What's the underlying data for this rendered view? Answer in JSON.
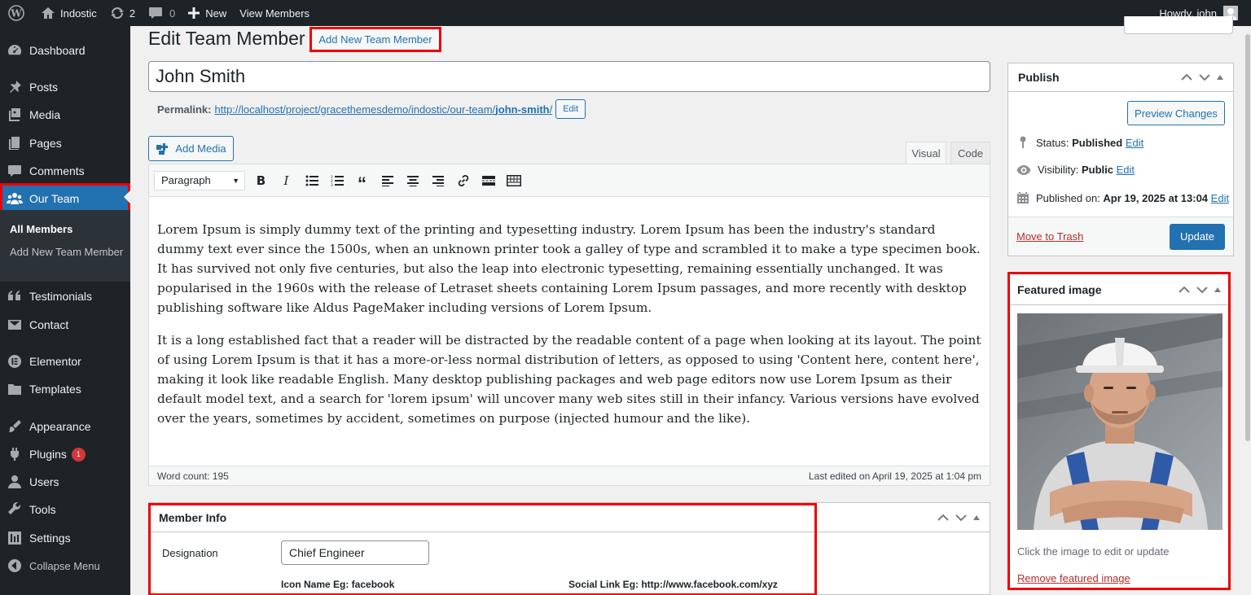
{
  "adminbar": {
    "site_name": "Indostic",
    "updates_count": "2",
    "comments_count": "0",
    "new_label": "New",
    "view_label": "View Members",
    "howdy": "Howdy, john"
  },
  "sidebar": {
    "dashboard": "Dashboard",
    "posts": "Posts",
    "media": "Media",
    "pages": "Pages",
    "comments": "Comments",
    "our_team": "Our Team",
    "sub_all": "All Members",
    "sub_add": "Add New Team Member",
    "testimonials": "Testimonials",
    "contact": "Contact",
    "elementor": "Elementor",
    "templates": "Templates",
    "appearance": "Appearance",
    "plugins": "Plugins",
    "plugins_badge": "1",
    "users": "Users",
    "tools": "Tools",
    "settings": "Settings",
    "collapse": "Collapse Menu"
  },
  "header": {
    "title": "Edit Team Member",
    "add_new": "Add New Team Member"
  },
  "post": {
    "title": "John Smith",
    "permalink_label": "Permalink:",
    "permalink_base": "http://localhost/project/gracethemesdemo/indostic/our-team/",
    "permalink_slug": "john-smith",
    "permalink_trail": "/",
    "permalink_edit": "Edit"
  },
  "editor": {
    "add_media": "Add Media",
    "tab_visual": "Visual",
    "tab_code": "Code",
    "format": "Paragraph",
    "paragraph_1": "Lorem Ipsum is simply dummy text of the printing and typesetting industry. Lorem Ipsum has been the industry's standard dummy text ever since the 1500s, when an unknown printer took a galley of type and scrambled it to make a type specimen book. It has survived not only five centuries, but also the leap into electronic typesetting, remaining essentially unchanged. It was popularised in the 1960s with the release of Letraset sheets containing Lorem Ipsum passages, and more recently with desktop publishing software like Aldus PageMaker including versions of Lorem Ipsum.",
    "paragraph_2": "It is a long established fact that a reader will be distracted by the readable content of a page when looking at its layout. The point of using Lorem Ipsum is that it has a more-or-less normal distribution of letters, as opposed to using 'Content here, content here', making it look like readable English. Many desktop publishing packages and web page editors now use Lorem Ipsum as their default model text, and a search for 'lorem ipsum' will uncover many web sites still in their infancy. Various versions have evolved over the years, sometimes by accident, sometimes on purpose (injected humour and the like).",
    "word_count": "Word count: 195",
    "last_edited": "Last edited on April 19, 2025 at 1:04 pm"
  },
  "member_info": {
    "title": "Member Info",
    "designation_label": "Designation",
    "designation_value": "Chief Engineer",
    "hint_icon": "Icon Name Eg: facebook",
    "hint_social": "Social Link Eg: http://www.facebook.com/xyz"
  },
  "publish": {
    "title": "Publish",
    "preview": "Preview Changes",
    "status_label": "Status:",
    "status_value": "Published",
    "visibility_label": "Visibility:",
    "visibility_value": "Public",
    "published_label": "Published on:",
    "published_value": "Apr 19, 2025 at 13:04",
    "edit": "Edit",
    "trash": "Move to Trash",
    "update": "Update"
  },
  "featured": {
    "title": "Featured image",
    "caption": "Click the image to edit or update",
    "remove": "Remove featured image"
  }
}
